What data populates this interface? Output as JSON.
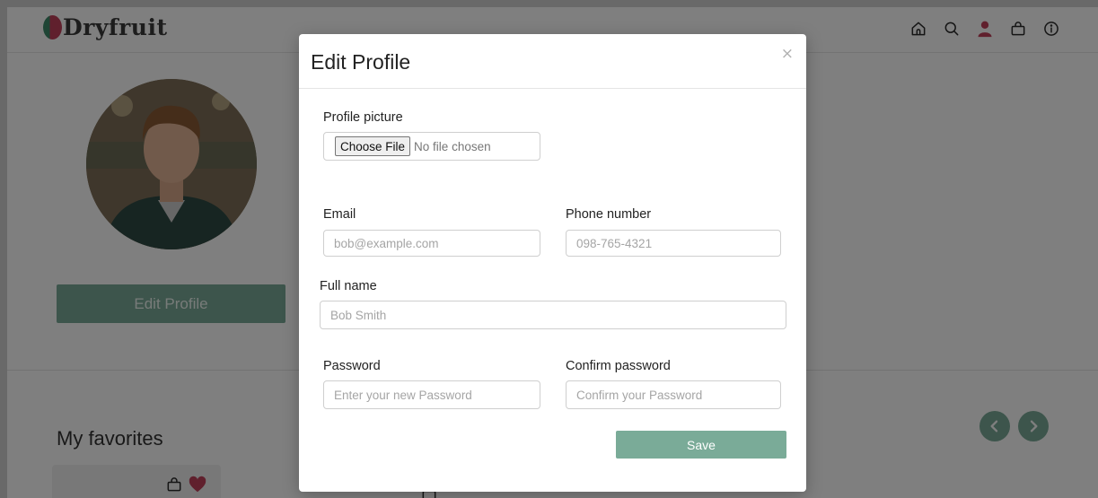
{
  "brand": {
    "name": "Dryfruit",
    "accent_color": "#7aab98",
    "logo_colors": [
      "#3e8a6a",
      "#c0405b"
    ]
  },
  "header": {
    "nav_icons": [
      {
        "name": "home-icon"
      },
      {
        "name": "search-icon"
      },
      {
        "name": "user-icon",
        "color": "#c0405b"
      },
      {
        "name": "shopping-bag-icon"
      },
      {
        "name": "info-icon"
      }
    ]
  },
  "profile": {
    "edit_button_label": "Edit Profile"
  },
  "favorites": {
    "title": "My favorites",
    "card_icons": [
      "shopping-bag-icon",
      "heart-icon"
    ]
  },
  "modal": {
    "title": "Edit Profile",
    "close_label": "×",
    "profile_picture_label": "Profile picture",
    "choose_file_label": "Choose File",
    "no_file_text": "No file chosen",
    "email_label": "Email",
    "email_placeholder": "bob@example.com",
    "phone_label": "Phone number",
    "phone_placeholder": "098-765-4321",
    "fullname_label": "Full name",
    "fullname_placeholder": "Bob Smith",
    "password_label": "Password",
    "password_placeholder": "Enter your new Password",
    "confirm_label": "Confirm password",
    "confirm_placeholder": "Confirm your Password",
    "save_label": "Save"
  }
}
